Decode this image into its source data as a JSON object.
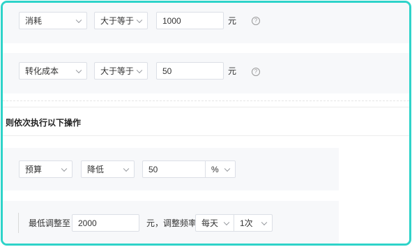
{
  "condition1": {
    "metric": "消耗",
    "operator": "大于等于",
    "value": "1000",
    "unit": "元",
    "help_icon": "question-circle-icon"
  },
  "condition2": {
    "metric": "转化成本",
    "operator": "大于等于",
    "value": "50",
    "unit": "元",
    "help_icon": "question-circle-icon"
  },
  "actions_title": "则依次执行以下操作",
  "action1": {
    "target": "预算",
    "direction": "降低",
    "value": "50",
    "unit_option": "%"
  },
  "action2": {
    "min_label": "最低调整至",
    "min_value": "2000",
    "freq_label": "元，调整频率",
    "period": "每天",
    "times": "1次"
  },
  "colors": {
    "frame_border": "#2ed3c9",
    "band": "#f7f8fa",
    "input_border": "#dcdfe6"
  }
}
